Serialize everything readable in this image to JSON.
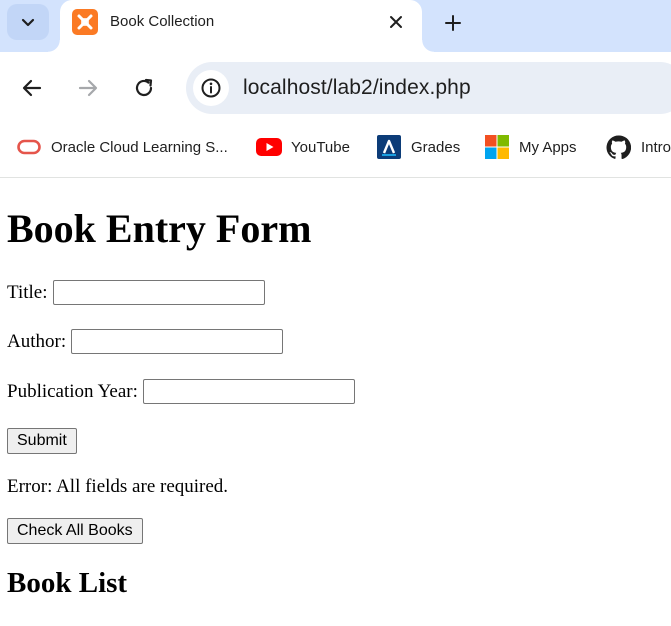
{
  "browser": {
    "tab": {
      "title": "Book Collection"
    },
    "address_bar": {
      "url": "localhost/lab2/index.php"
    },
    "bookmarks": [
      {
        "label": "Oracle Cloud Learning S...",
        "icon": "oracle-icon"
      },
      {
        "label": "YouTube",
        "icon": "youtube-icon"
      },
      {
        "label": "Grades",
        "icon": "grades-icon"
      },
      {
        "label": "My Apps",
        "icon": "my-apps-icon"
      },
      {
        "label": "Intro",
        "icon": "github-icon"
      }
    ]
  },
  "page": {
    "heading": "Book Entry Form",
    "form": {
      "title_label": "Title:",
      "title_value": "",
      "author_label": "Author:",
      "author_value": "",
      "year_label": "Publication Year:",
      "year_value": "",
      "submit_label": "Submit"
    },
    "error_message": "Error: All fields are required.",
    "check_books_label": "Check All Books",
    "list_heading": "Book List"
  },
  "colors": {
    "tabstrip_bg": "#d3e3fd",
    "omnibox_bg": "#e9eef6",
    "xampp_orange": "#fb7a24",
    "youtube_red": "#ff0000",
    "oracle_red": "#e5554b"
  }
}
